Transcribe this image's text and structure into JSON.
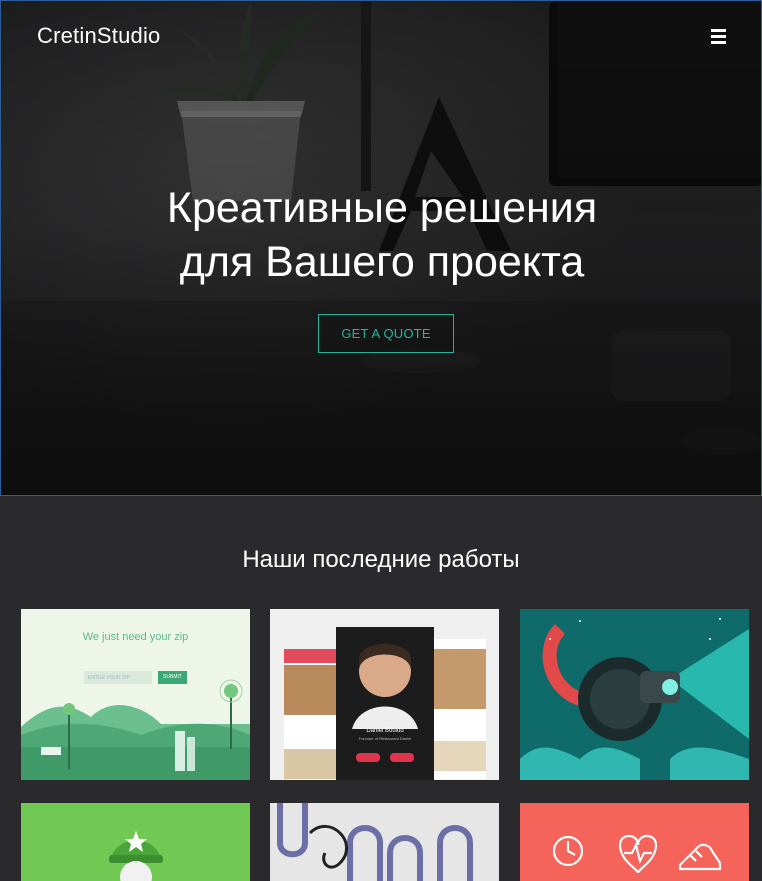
{
  "header": {
    "logo_text": "CretinStudio",
    "menu_icon": "hamburger-menu-icon"
  },
  "hero": {
    "title_line1": "Креативные решения",
    "title_line2": "для Вашего проекта",
    "cta_label": "GET A QUOTE",
    "accent_color": "#25b39a"
  },
  "portfolio": {
    "section_title": "Наши последние работы",
    "items": [
      {
        "name": "zip-landing",
        "headline": "We just need your zip",
        "placeholder": "ENTER YOUR ZIP",
        "button": "SUBMIT"
      },
      {
        "name": "chef-app",
        "chef_name": "Daniel Boulud",
        "chef_role": "Founder of Restaurant Daniel"
      },
      {
        "name": "robot-illustration"
      },
      {
        "name": "green-character"
      },
      {
        "name": "typography"
      },
      {
        "name": "health-icons"
      }
    ]
  }
}
